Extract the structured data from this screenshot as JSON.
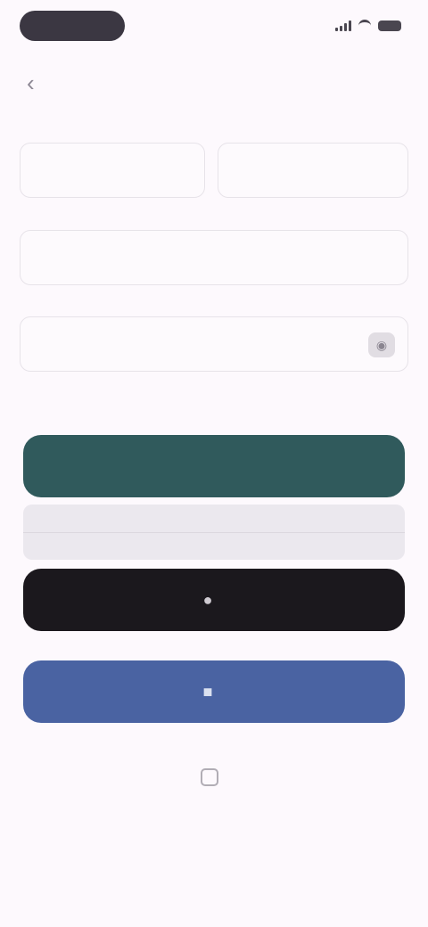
{
  "status_bar": {
    "time": ""
  },
  "header": {
    "back_icon": "chevron-left-icon",
    "title": ""
  },
  "form": {
    "first_name": {
      "value": "",
      "placeholder": ""
    },
    "last_name": {
      "value": "",
      "placeholder": ""
    },
    "email": {
      "value": "",
      "placeholder": ""
    },
    "password": {
      "value": "",
      "placeholder": ""
    },
    "password_hint": ""
  },
  "actions": {
    "primary_label": "",
    "divider_label": "",
    "apple_label": "",
    "facebook_label": "",
    "footer_label": ""
  },
  "colors": {
    "background": "#fdf9fd",
    "primary_button": "#305a5c",
    "apple_button": "#1b181d",
    "facebook_button": "#4a63a2"
  }
}
